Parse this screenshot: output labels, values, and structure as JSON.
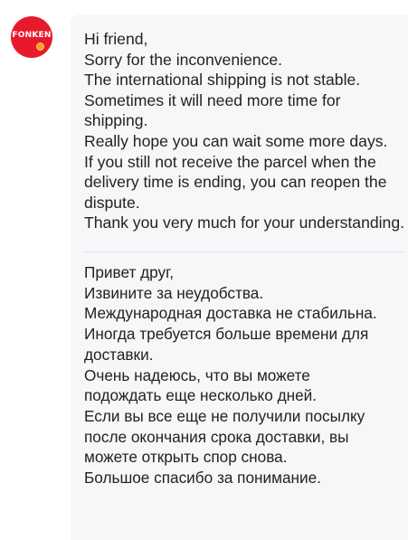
{
  "avatar": {
    "brand_text": "FONKEN",
    "bg_color": "#e8192c",
    "accent_color": "#f7a21b"
  },
  "message": {
    "english": "Hi friend,\nSorry for the inconvenience.\nThe international shipping is not stable.\nSometimes it will need more time for shipping.\nReally hope you can wait some more days.\nIf you still not receive the parcel when the delivery time is ending, you can reopen the dispute.\nThank you very much for your understanding.",
    "russian": "Привет друг,\nИзвините за неудобства.\nМеждународная доставка не стабильна.\nИногда требуется больше времени для доставки.\nОчень надеюсь, что вы можете подождать еще несколько дней.\nЕсли вы все еще не получили посылку после окончания срока доставки, вы можете открыть спор снова.\nБольшое спасибо за понимание."
  }
}
